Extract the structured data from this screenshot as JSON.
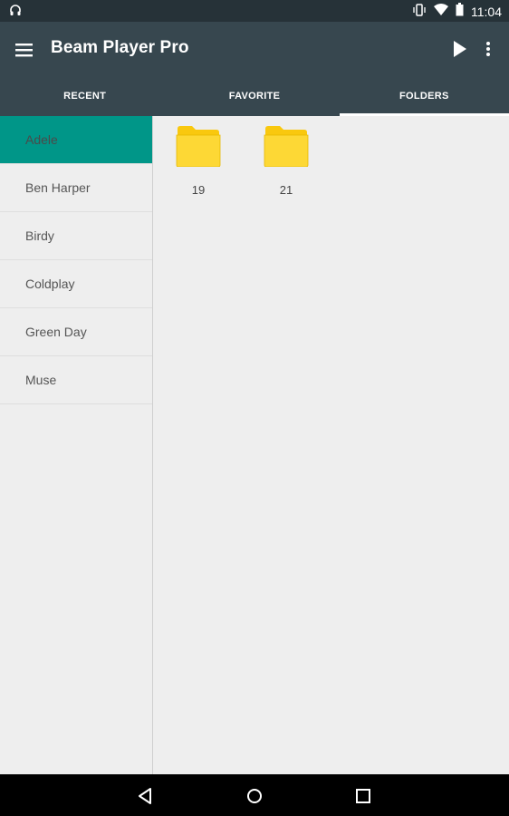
{
  "status_bar": {
    "time": "11:04",
    "icons": [
      "headphones-icon",
      "vibrate-icon",
      "wifi-icon",
      "battery-icon"
    ]
  },
  "app_bar": {
    "title": "Beam Player Pro",
    "icons": [
      "menu-icon",
      "play-icon",
      "more-vert-icon"
    ]
  },
  "tabs": [
    {
      "label": "RECENT",
      "active": false
    },
    {
      "label": "FAVORITE",
      "active": false
    },
    {
      "label": "FOLDERS",
      "active": true
    }
  ],
  "sidebar": {
    "items": [
      {
        "label": "Adele",
        "selected": true
      },
      {
        "label": "Ben Harper",
        "selected": false
      },
      {
        "label": "Birdy",
        "selected": false
      },
      {
        "label": "Coldplay",
        "selected": false
      },
      {
        "label": "Green Day",
        "selected": false
      },
      {
        "label": "Muse",
        "selected": false
      }
    ]
  },
  "folders": [
    {
      "label": "19",
      "icon": "folder-icon"
    },
    {
      "label": "21",
      "icon": "folder-icon"
    }
  ],
  "nav_bar": {
    "icons": [
      "back-icon",
      "home-icon",
      "recents-icon"
    ]
  },
  "colors": {
    "status_bar": "#263238",
    "app_bar": "#37474f",
    "accent": "#009688",
    "folder": "#fdd835",
    "background": "#eeeeee"
  }
}
